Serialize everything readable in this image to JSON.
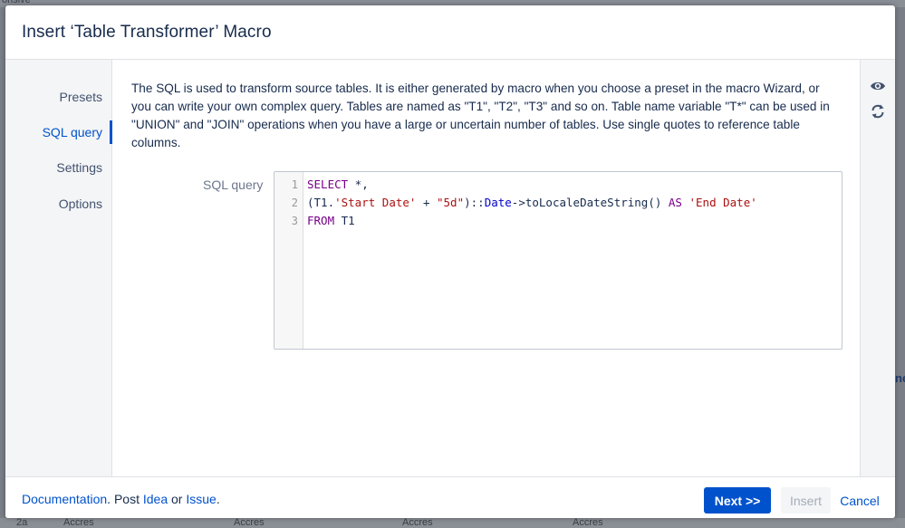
{
  "dialog": {
    "title": "Insert ‘Table Transformer’ Macro"
  },
  "nav": {
    "items": [
      {
        "label": "Presets"
      },
      {
        "label": "SQL query"
      },
      {
        "label": "Settings"
      },
      {
        "label": "Options"
      }
    ],
    "active": "SQL query"
  },
  "content": {
    "description": "The SQL is used to transform source tables. It is either generated by macro when you choose a preset in the macro Wizard, or you can write your own complex query. Tables are named as \"T1\", \"T2\", \"T3\" and so on. Table name variable \"T*\" can be used in \"UNION\" and \"JOIN\" operations when you have a large or uncertain number of tables. Use single quotes to reference table columns.",
    "field_label": "SQL query",
    "editor": {
      "line_numbers": [
        "1",
        "2",
        "3"
      ],
      "line1": {
        "kw": "SELECT",
        "rest": " *,"
      },
      "line2": {
        "open": "(T1.",
        "str1": "'Start Date'",
        "plus": " + ",
        "str2": "\"5d\"",
        "cast": ")::",
        "type": "Date",
        "arrow": "->",
        "fn": "toLocaleDateString",
        "call": "() ",
        "as": "AS",
        "sp": " ",
        "str3": "'End Date'"
      },
      "line3": {
        "kw": "FROM",
        "rest": " T1"
      }
    }
  },
  "rail": {
    "icons": [
      "eye-icon",
      "refresh-icon"
    ]
  },
  "footer": {
    "doc_link": "Documentation",
    "text_post": ". Post ",
    "idea_link": "Idea",
    "text_or": " or ",
    "issue_link": "Issue",
    "text_end": ".",
    "next_label": "Next >>",
    "insert_label": "Insert",
    "cancel_label": "Cancel"
  },
  "background": {
    "top_fragment": "orisive",
    "bottom_cells": [
      "2a",
      "Accres",
      "Accres",
      "Accres",
      "Accres"
    ],
    "right_fragment": "ne"
  },
  "colors": {
    "primary": "#0052cc",
    "text": "#172b4d",
    "subtle": "#6b778c",
    "panel": "#f4f5f7"
  }
}
